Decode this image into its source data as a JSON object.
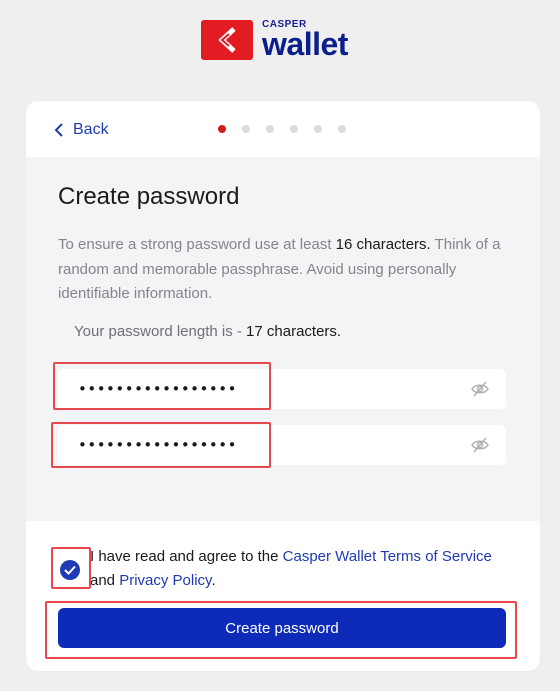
{
  "brand": {
    "small_text": "CASPER",
    "big_text": "wallet",
    "mark_color": "#e31b23",
    "text_color": "#0b1f8a"
  },
  "nav": {
    "back_label": "Back",
    "step_count": 6,
    "current_step": 1
  },
  "form": {
    "title": "Create password",
    "description": {
      "prefix": "To ensure a strong password use at least ",
      "highlight": "16 characters.",
      "suffix": " Think of a random and memorable passphrase. Avoid using personally identifiable information."
    },
    "length_label": "Your password length is - ",
    "length_value": "17 characters.",
    "password_value": "•••••••••••••••••",
    "confirm_value": "•••••••••••••••••",
    "eye_icon": "eye-off-icon"
  },
  "terms": {
    "checked": true,
    "prefix": "I have read and agree to the ",
    "terms_link": "Casper Wallet Terms of Service",
    "and_text": " and ",
    "privacy_link": "Privacy Policy",
    "suffix": "."
  },
  "submit_label": "Create password",
  "colors": {
    "accent": "#1e3bb3",
    "button": "#0d2bb8",
    "active_dot": "#d11a1a",
    "highlight": "#e5484d"
  }
}
